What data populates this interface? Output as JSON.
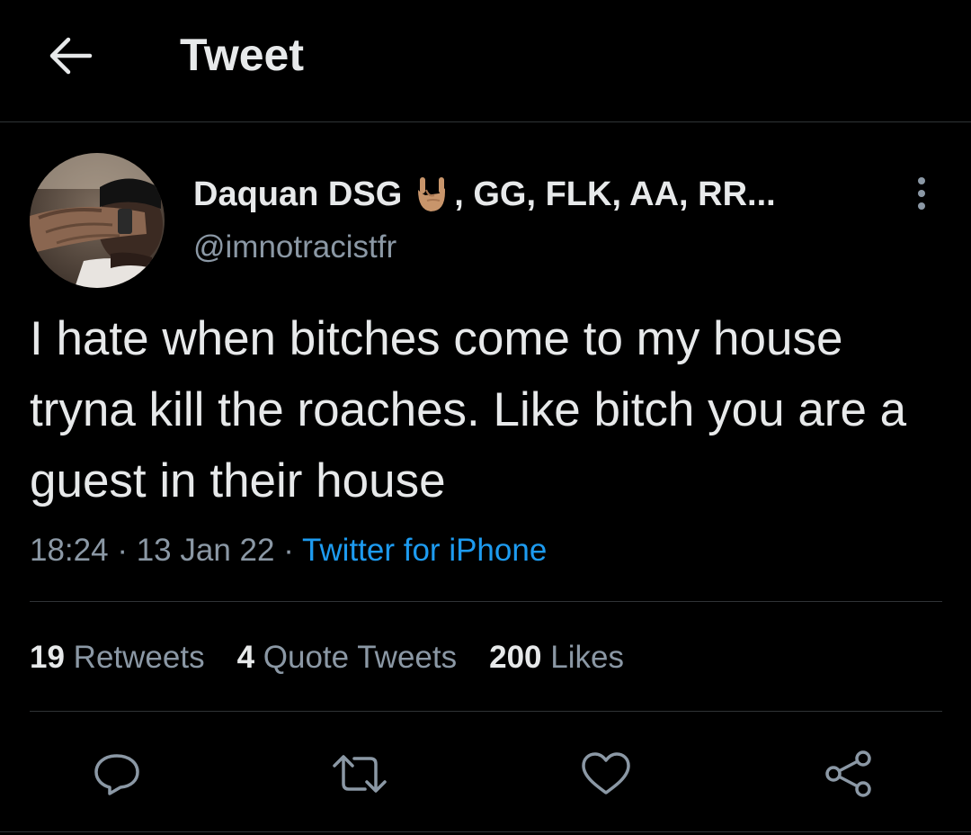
{
  "header": {
    "title": "Tweet",
    "back_icon": "arrow-left-icon"
  },
  "author": {
    "display_name": "Daquan DSG",
    "name_suffix": ", GG, FLK, AA, RR...",
    "name_emoji": "sign-of-horns-emoji",
    "handle": "@imnotracistfr"
  },
  "tweet": {
    "text": "I hate when bitches come to my house tryna kill the roaches. Like bitch you are a guest in their house",
    "time": "18:24",
    "date": "13 Jan 22",
    "separator": "·",
    "source": "Twitter for iPhone"
  },
  "stats": {
    "retweets_count": "19",
    "retweets_label": "Retweets",
    "quotes_count": "4",
    "quotes_label": "Quote Tweets",
    "likes_count": "200",
    "likes_label": "Likes"
  },
  "actions": [
    "reply-icon",
    "retweet-icon",
    "like-icon",
    "share-icon"
  ],
  "colors": {
    "background": "#000000",
    "text": "#e7e9ea",
    "secondary": "#8b98a5",
    "link": "#1d9bf0",
    "divider": "#2f3336"
  }
}
